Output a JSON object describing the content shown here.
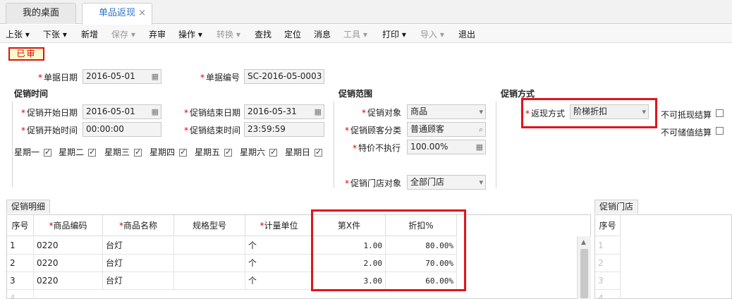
{
  "tabs": [
    {
      "label": "我的桌面"
    },
    {
      "label": "单品返现",
      "close": "×"
    }
  ],
  "toolbar": {
    "prev": "上张 ▾",
    "next": "下张 ▾",
    "new": "新增",
    "save": "保存 ▾",
    "approve": "弃审",
    "operate": "操作 ▾",
    "convert": "转换 ▾",
    "find": "查找",
    "locate": "定位",
    "message": "消息",
    "tools": "工具 ▾",
    "print": "打印 ▾",
    "import": "导入 ▾",
    "exit": "退出"
  },
  "status": "已审",
  "header": {
    "doc_date_label": "单据日期",
    "doc_date": "2016-05-01",
    "doc_no_label": "单据编号",
    "doc_no": "SC-2016-05-0003"
  },
  "promo_time": {
    "title": "促销时间",
    "start_date_label": "促销开始日期",
    "start_date": "2016-05-01",
    "end_date_label": "促销结束日期",
    "end_date": "2016-05-31",
    "start_time_label": "促销开始时间",
    "start_time": "00:00:00",
    "end_time_label": "促销结束时间",
    "end_time": "23:59:59",
    "weekdays": [
      {
        "label": "星期一",
        "checked": true
      },
      {
        "label": "星期二",
        "checked": true
      },
      {
        "label": "星期三",
        "checked": true
      },
      {
        "label": "星期四",
        "checked": true
      },
      {
        "label": "星期五",
        "checked": true
      },
      {
        "label": "星期六",
        "checked": true
      },
      {
        "label": "星期日",
        "checked": true
      }
    ]
  },
  "promo_scope": {
    "title": "促销范围",
    "target_label": "促销对象",
    "target": "商品",
    "customer_label": "促销顾客分类",
    "customer": "普通顾客",
    "special_label": "特价不执行",
    "special": "100.00%",
    "store_label": "促销门店对象",
    "store": "全部门店"
  },
  "promo_method": {
    "title": "促销方式",
    "cashback_label": "返现方式",
    "cashback": "阶梯折扣",
    "no_offset_label": "不可抵现结算",
    "no_stored_label": "不可储值结算"
  },
  "detail": {
    "tab": "促销明细",
    "columns": [
      "序号",
      "商品编码",
      "商品名称",
      "规格型号",
      "计量单位",
      "第X件",
      "折扣%"
    ],
    "rows": [
      {
        "no": "1",
        "code": "0220",
        "name": "台灯",
        "spec": "",
        "unit": "个",
        "nth": "1.00",
        "discount": "80.00%"
      },
      {
        "no": "2",
        "code": "0220",
        "name": "台灯",
        "spec": "",
        "unit": "个",
        "nth": "2.00",
        "discount": "70.00%"
      },
      {
        "no": "3",
        "code": "0220",
        "name": "台灯",
        "spec": "",
        "unit": "个",
        "nth": "3.00",
        "discount": "60.00%"
      }
    ],
    "next_row_no": "4"
  },
  "stores": {
    "tab": "促销门店",
    "column": "序号",
    "rows": [
      "1",
      "2",
      "3",
      "4"
    ]
  },
  "colors": {
    "highlight": "#e0141e",
    "required": "#d00",
    "active_tab": "#2f74c0"
  }
}
